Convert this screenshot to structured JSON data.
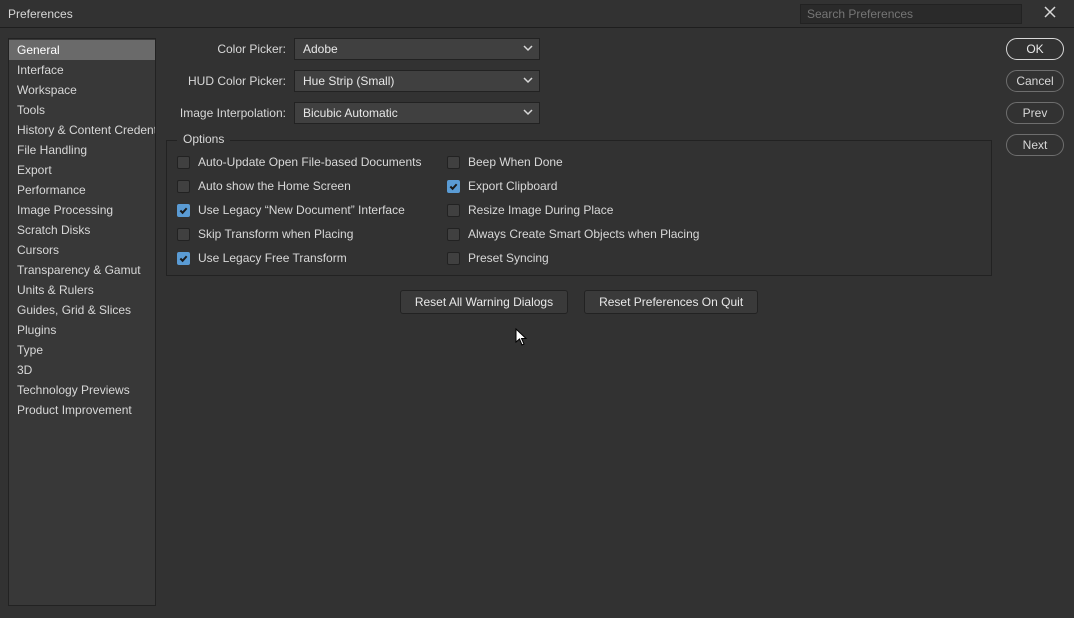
{
  "window": {
    "title": "Preferences"
  },
  "search": {
    "placeholder": "Search Preferences"
  },
  "sidebar": {
    "items": [
      {
        "label": "General",
        "selected": true
      },
      {
        "label": "Interface",
        "selected": false
      },
      {
        "label": "Workspace",
        "selected": false
      },
      {
        "label": "Tools",
        "selected": false
      },
      {
        "label": "History & Content Credentials",
        "selected": false
      },
      {
        "label": "File Handling",
        "selected": false
      },
      {
        "label": "Export",
        "selected": false
      },
      {
        "label": "Performance",
        "selected": false
      },
      {
        "label": "Image Processing",
        "selected": false
      },
      {
        "label": "Scratch Disks",
        "selected": false
      },
      {
        "label": "Cursors",
        "selected": false
      },
      {
        "label": "Transparency & Gamut",
        "selected": false
      },
      {
        "label": "Units & Rulers",
        "selected": false
      },
      {
        "label": "Guides, Grid & Slices",
        "selected": false
      },
      {
        "label": "Plugins",
        "selected": false
      },
      {
        "label": "Type",
        "selected": false
      },
      {
        "label": "3D",
        "selected": false
      },
      {
        "label": "Technology Previews",
        "selected": false
      },
      {
        "label": "Product Improvement",
        "selected": false
      }
    ]
  },
  "form": {
    "color_picker": {
      "label": "Color Picker:",
      "value": "Adobe"
    },
    "hud_color_picker": {
      "label": "HUD Color Picker:",
      "value": "Hue Strip (Small)"
    },
    "image_interpolation": {
      "label": "Image Interpolation:",
      "value": "Bicubic Automatic"
    }
  },
  "options": {
    "legend": "Options",
    "left": [
      {
        "label": "Auto-Update Open File-based Documents",
        "checked": false
      },
      {
        "label": "Auto show the Home Screen",
        "checked": false
      },
      {
        "label": "Use Legacy “New Document” Interface",
        "checked": true
      },
      {
        "label": "Skip Transform when Placing",
        "checked": false
      },
      {
        "label": "Use Legacy Free Transform",
        "checked": true
      }
    ],
    "right": [
      {
        "label": "Beep When Done",
        "checked": false
      },
      {
        "label": "Export Clipboard",
        "checked": true
      },
      {
        "label": "Resize Image During Place",
        "checked": false
      },
      {
        "label": "Always Create Smart Objects when Placing",
        "checked": false
      },
      {
        "label": "Preset Syncing",
        "checked": false
      }
    ]
  },
  "reset": {
    "warning": "Reset All Warning Dialogs",
    "on_quit": "Reset Preferences On Quit"
  },
  "buttons": {
    "ok": "OK",
    "cancel": "Cancel",
    "prev": "Prev",
    "next": "Next"
  }
}
